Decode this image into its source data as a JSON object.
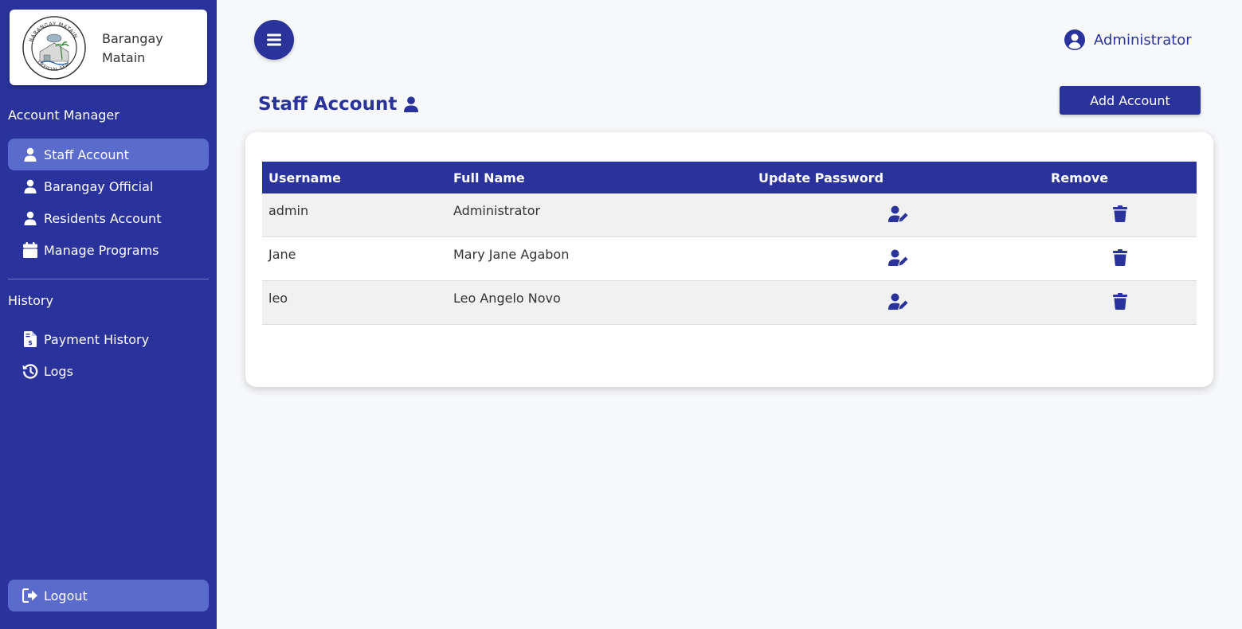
{
  "brand": {
    "line1": "Barangay",
    "line2": "Matain",
    "seal_text_top": "BARANGAY MATAIN",
    "seal_text_bottom": "OFFICIAL SEAL"
  },
  "sidebar": {
    "account_manager_title": "Account Manager",
    "account_items": [
      {
        "label": "Staff Account",
        "icon": "user-icon",
        "active": true
      },
      {
        "label": "Barangay Official",
        "icon": "user-icon",
        "active": false
      },
      {
        "label": "Residents Account",
        "icon": "user-icon",
        "active": false
      },
      {
        "label": "Manage Programs",
        "icon": "calendar-icon",
        "active": false
      }
    ],
    "history_title": "History",
    "history_items": [
      {
        "label": "Payment History",
        "icon": "invoice-icon"
      },
      {
        "label": "Logs",
        "icon": "history-icon"
      }
    ],
    "logout_label": "Logout"
  },
  "header": {
    "user_name": "Administrator"
  },
  "page": {
    "title": "Staff Account",
    "add_button": "Add Account"
  },
  "table": {
    "headers": [
      "Username",
      "Full Name",
      "Update Password",
      "Remove"
    ],
    "rows": [
      {
        "username": "admin",
        "full_name": "Administrator"
      },
      {
        "username": "Jane",
        "full_name": "Mary Jane Agabon"
      },
      {
        "username": "leo",
        "full_name": "Leo Angelo Novo"
      }
    ]
  },
  "colors": {
    "primary": "#29339b",
    "sidebar_active": "#5b6bcb",
    "background": "#f7f8fa"
  }
}
